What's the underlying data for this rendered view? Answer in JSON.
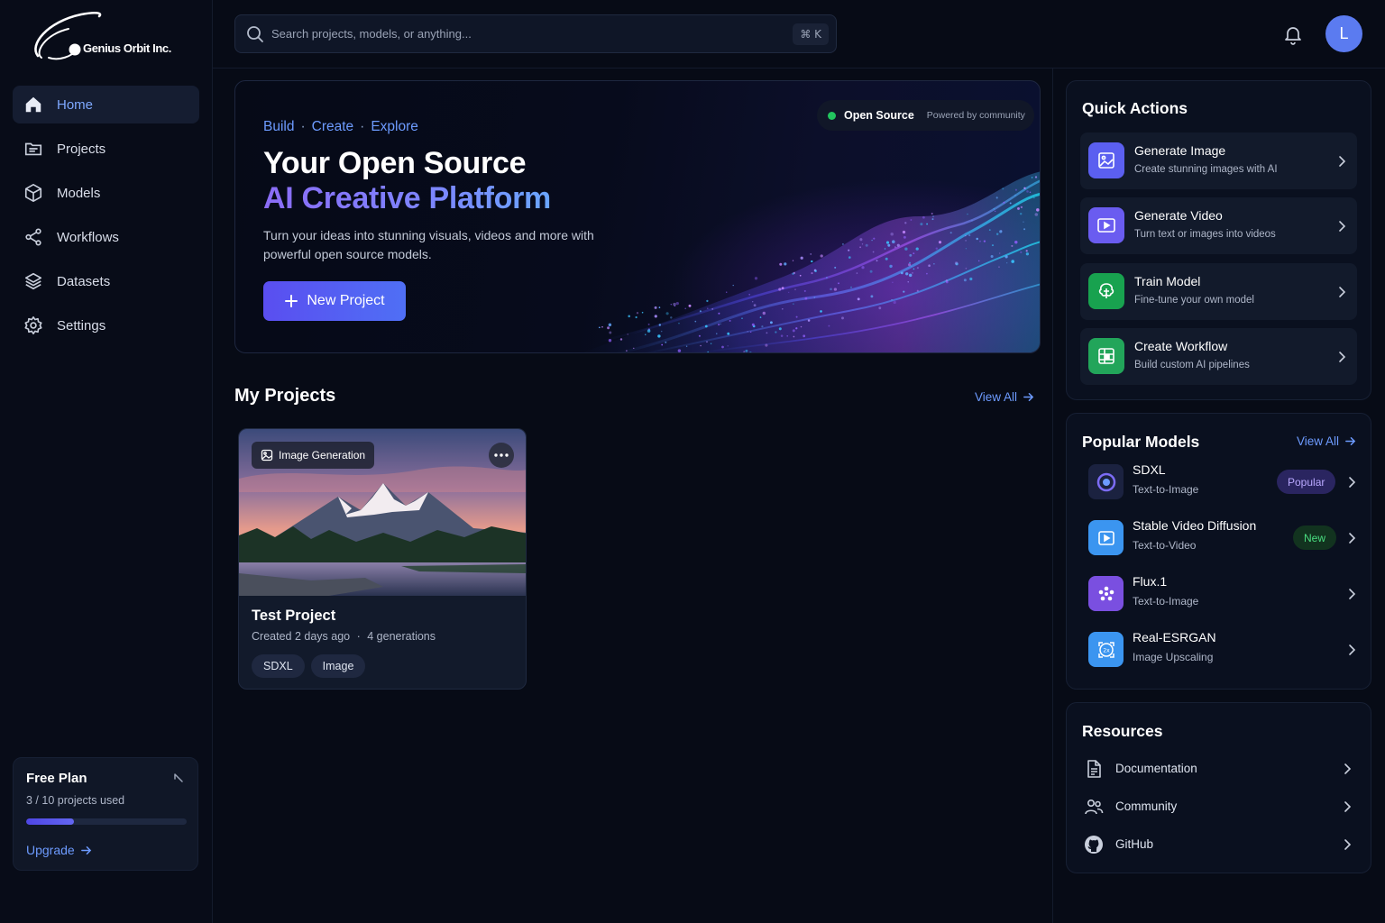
{
  "brand": {
    "name": "Genius Orbit Inc."
  },
  "sidebar": {
    "items": [
      {
        "label": "Home",
        "icon": "home-icon",
        "active": true
      },
      {
        "label": "Projects",
        "icon": "folder-icon"
      },
      {
        "label": "Models",
        "icon": "cube-icon"
      },
      {
        "label": "Workflows",
        "icon": "workflow-icon"
      },
      {
        "label": "Datasets",
        "icon": "layers-icon"
      },
      {
        "label": "Settings",
        "icon": "gear-icon"
      }
    ],
    "plan": {
      "title": "Free Plan",
      "usage": "3 / 10 projects used",
      "used": 3,
      "total": 10,
      "upgrade_label": "Upgrade"
    }
  },
  "topbar": {
    "search_placeholder": "Search projects, models, or anything...",
    "shortcut": "⌘ K",
    "avatar_initial": "L"
  },
  "hero": {
    "eyebrow": [
      "Build",
      "Create",
      "Explore"
    ],
    "eyebrow_separator": "·",
    "badge_label": "Open Source",
    "badge_sub": "Powered by community",
    "title_line1": "Your Open Source",
    "title_line2": "AI Creative Platform",
    "description": "Turn your ideas into stunning visuals, videos and more with powerful open source models.",
    "cta_label": "New Project"
  },
  "projects": {
    "title": "My Projects",
    "view_all": "View All",
    "items": [
      {
        "tag": "Image Generation",
        "title": "Test Project",
        "created": "Created 2 days ago",
        "separator": "·",
        "generations": "4 generations",
        "chips": [
          "SDXL",
          "Image"
        ]
      }
    ]
  },
  "quick_actions": {
    "title": "Quick Actions",
    "items": [
      {
        "title": "Generate Image",
        "subtitle": "Create stunning images with AI",
        "icon": "image-icon",
        "color": "#6366f1"
      },
      {
        "title": "Generate Video",
        "subtitle": "Turn text or images into videos",
        "icon": "video-icon",
        "color": "#6d5ef5"
      },
      {
        "title": "Train Model",
        "subtitle": "Fine-tune your own model",
        "icon": "brain-icon",
        "color": "#16a34a"
      },
      {
        "title": "Create Workflow",
        "subtitle": "Build custom AI pipelines",
        "icon": "workflow-grid-icon",
        "color": "#22a55a"
      }
    ]
  },
  "popular_models": {
    "title": "Popular Models",
    "view_all": "View All",
    "items": [
      {
        "name": "SDXL",
        "type": "Text-to-Image",
        "badge": "Popular",
        "icon": "sdxl-logo-icon"
      },
      {
        "name": "Stable Video Diffusion",
        "type": "Text-to-Video",
        "badge": "New",
        "icon": "video-play-icon"
      },
      {
        "name": "Flux.1",
        "type": "Text-to-Image",
        "badge": "",
        "icon": "flux-logo-icon"
      },
      {
        "name": "Real-ESRGAN",
        "type": "Image Upscaling",
        "badge": "",
        "icon": "upscale-icon"
      }
    ]
  },
  "resources": {
    "title": "Resources",
    "items": [
      {
        "label": "Documentation",
        "icon": "document-icon"
      },
      {
        "label": "Community",
        "icon": "users-icon"
      },
      {
        "label": "GitHub",
        "icon": "github-icon"
      }
    ]
  },
  "colors": {
    "accent": "#6d9bff",
    "primary_button": "#5a4ef0",
    "background": "#070b16",
    "status_online": "#22c55e",
    "badge_popular_bg": "#2a2560",
    "badge_new_bg": "#12331f"
  }
}
